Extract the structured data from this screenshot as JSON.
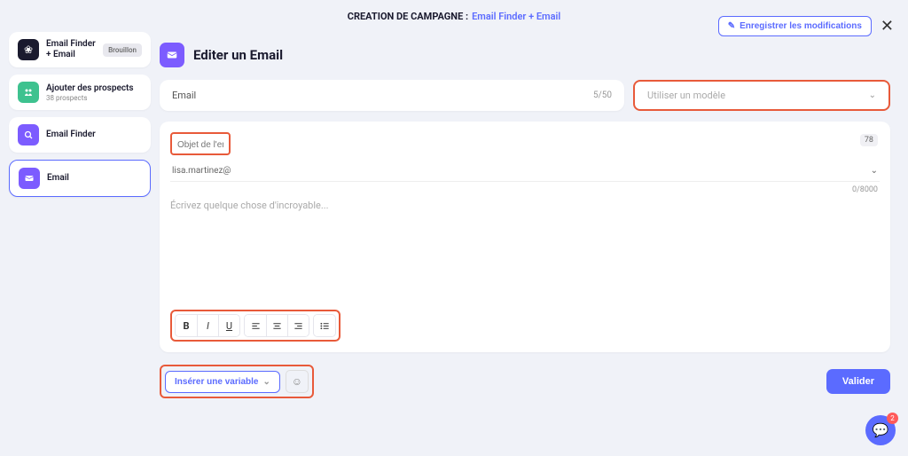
{
  "header": {
    "title_prefix": "CREATION DE CAMPAGNE :",
    "title_link": "Email Finder + Email",
    "save_label": "Enregistrer les modifications"
  },
  "sidebar": {
    "items": [
      {
        "title": "Email Finder + Email",
        "badge": "Brouillon"
      },
      {
        "title": "Ajouter des prospects",
        "sub": "38 prospects"
      },
      {
        "title": "Email Finder"
      },
      {
        "title": "Email"
      }
    ]
  },
  "page": {
    "title": "Editer un Email",
    "name_field_label": "Email",
    "name_field_count": "5/50",
    "template_placeholder": "Utiliser un modèle",
    "subject_placeholder": "Objet de l'email",
    "subject_count": "78",
    "from_email": "lisa.martinez@",
    "body_placeholder": "Écrivez quelque chose d'incroyable...",
    "body_count": "0/8000",
    "insert_var_label": "Insérer une variable",
    "validate_label": "Valider"
  },
  "chat": {
    "unread": "2"
  }
}
